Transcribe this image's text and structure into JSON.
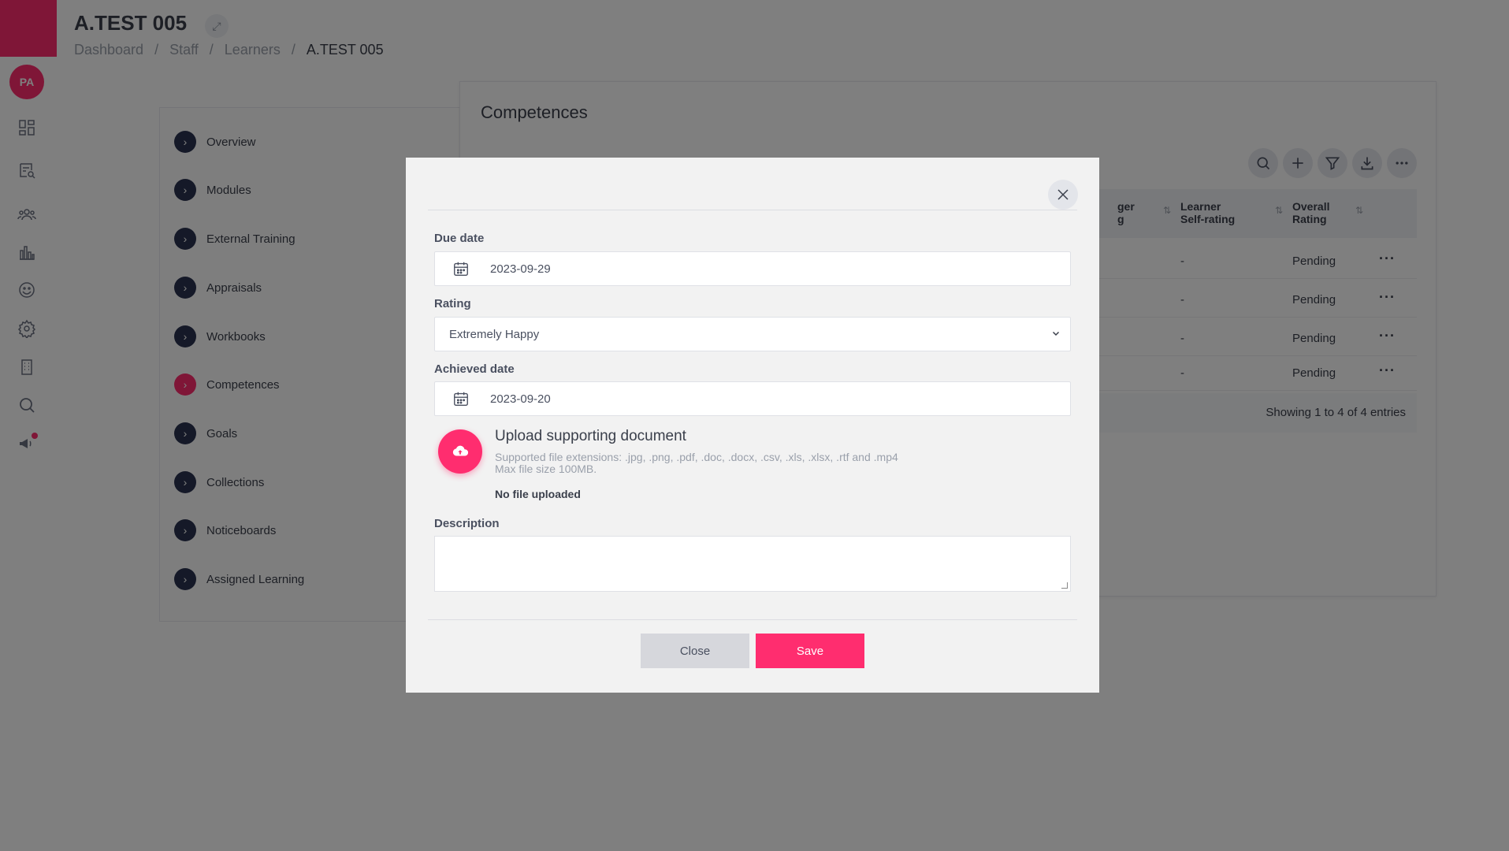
{
  "sidebar": {
    "avatar_initials": "PA",
    "icons": [
      "dashboard-icon",
      "search-document-icon",
      "users-icon",
      "chart-icon",
      "smiley-icon",
      "gear-icon",
      "building-icon",
      "search-icon",
      "megaphone-icon"
    ]
  },
  "header": {
    "title": "A.TEST 005",
    "breadcrumb": [
      "Dashboard",
      "/",
      "Staff",
      "/",
      "Learners",
      "/",
      "A.TEST 005"
    ]
  },
  "menu": {
    "items": [
      {
        "label": "Overview"
      },
      {
        "label": "Modules"
      },
      {
        "label": "External Training"
      },
      {
        "label": "Appraisals"
      },
      {
        "label": "Workbooks"
      },
      {
        "label": "Competences"
      },
      {
        "label": "Goals"
      },
      {
        "label": "Collections"
      },
      {
        "label": "Noticeboards"
      },
      {
        "label": "Assigned Learning"
      }
    ],
    "active": "Competences"
  },
  "competences": {
    "title": "Competences",
    "columns": {
      "manager_line1": "ger",
      "manager_line2": "g",
      "learner_line1": "Learner",
      "learner_line2": "Self-rating",
      "overall_line1": "Overall",
      "overall_line2": "Rating"
    },
    "rows": [
      {
        "learner": "-",
        "overall": "Pending"
      },
      {
        "learner": "-",
        "overall": "Pending"
      },
      {
        "learner": "-",
        "overall": "Pending"
      },
      {
        "learner": "-",
        "overall": "Pending"
      }
    ],
    "footer": "Showing 1 to 4 of 4 entries"
  },
  "modal": {
    "due_date_label": "Due date",
    "due_date_value": "2023-09-29",
    "rating_label": "Rating",
    "rating_value": "Extremely Happy",
    "achieved_date_label": "Achieved date",
    "achieved_date_value": "2023-09-20",
    "upload_title": "Upload supporting document",
    "upload_hint_line1": "Supported file extensions: .jpg, .png, .pdf, .doc, .docx, .csv, .xls, .xlsx, .rtf and .mp4",
    "upload_hint_line2": "Max file size 100MB.",
    "upload_status": "No file uploaded",
    "description_label": "Description",
    "description_value": "",
    "close_label": "Close",
    "save_label": "Save"
  },
  "colors": {
    "accent": "#ff2d6f",
    "menu_chevron": "#2b3350",
    "modal_bg": "#f2f2f2"
  }
}
